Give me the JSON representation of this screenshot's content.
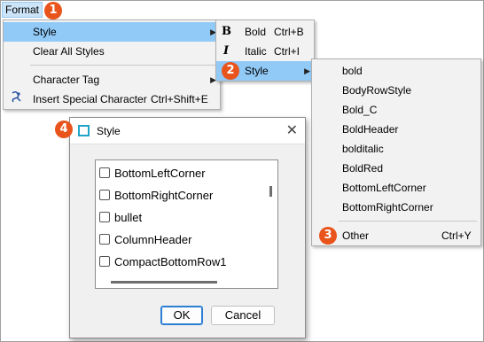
{
  "menubar": {
    "format_label": "Format"
  },
  "callouts": [
    "1",
    "2",
    "3",
    "4"
  ],
  "format_menu": {
    "items": [
      {
        "label": "Style",
        "shortcut": "",
        "has_submenu": true,
        "highlighted": true
      },
      {
        "label": "Clear All Styles",
        "shortcut": "",
        "has_submenu": false
      },
      {
        "label": "Character Tag",
        "shortcut": "",
        "has_submenu": true
      },
      {
        "label": "Insert Special Character",
        "shortcut": "Ctrl+Shift+E",
        "has_submenu": false,
        "icon": "special-character-icon"
      }
    ]
  },
  "style_menu": {
    "items": [
      {
        "label": "Bold",
        "shortcut": "Ctrl+B",
        "icon": "bold-icon",
        "icon_glyph": "B"
      },
      {
        "label": "Italic",
        "shortcut": "Ctrl+I",
        "icon": "italic-icon",
        "icon_glyph": "I"
      },
      {
        "label": "Style",
        "shortcut": "",
        "has_submenu": true,
        "highlighted": true
      }
    ]
  },
  "styles_submenu": {
    "items": [
      "bold",
      "BodyRowStyle",
      "Bold_C",
      "BoldHeader",
      "bolditalic",
      "BoldRed",
      "BottomLeftCorner",
      "BottomRightCorner"
    ],
    "other": {
      "label": "Other",
      "shortcut": "Ctrl+Y"
    }
  },
  "dialog": {
    "title": "Style",
    "close_glyph": "✕",
    "list_items": [
      "BottomLeftCorner",
      "BottomRightCorner",
      "bullet",
      "ColumnHeader",
      "CompactBottomRow1"
    ],
    "ok_label": "OK",
    "cancel_label": "Cancel"
  },
  "colors": {
    "highlight": "#91c9f7",
    "callout": "#e8541c",
    "menubar_active": "#cce4f7"
  }
}
